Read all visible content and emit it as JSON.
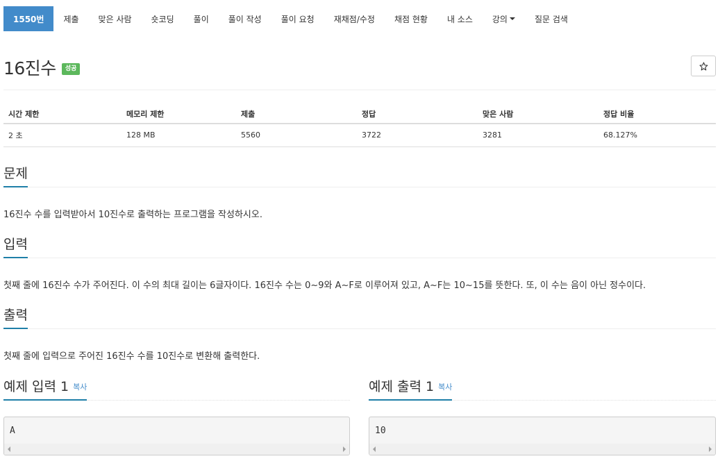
{
  "nav": {
    "items": [
      {
        "label": "1550번",
        "active": true,
        "name": "nav-problem-number"
      },
      {
        "label": "제출",
        "active": false,
        "name": "nav-submit"
      },
      {
        "label": "맞은 사람",
        "active": false,
        "name": "nav-solved-users"
      },
      {
        "label": "숏코딩",
        "active": false,
        "name": "nav-short-coding"
      },
      {
        "label": "풀이",
        "active": false,
        "name": "nav-solution"
      },
      {
        "label": "풀이 작성",
        "active": false,
        "name": "nav-write-solution"
      },
      {
        "label": "풀이 요청",
        "active": false,
        "name": "nav-request-solution"
      },
      {
        "label": "재채점/수정",
        "active": false,
        "name": "nav-rejudge"
      },
      {
        "label": "채점 현황",
        "active": false,
        "name": "nav-status"
      },
      {
        "label": "내 소스",
        "active": false,
        "name": "nav-my-source"
      },
      {
        "label": "강의",
        "active": false,
        "name": "nav-lecture",
        "dropdown": true
      },
      {
        "label": "질문 검색",
        "active": false,
        "name": "nav-question-search"
      }
    ]
  },
  "problem": {
    "title": "16진수",
    "badge": "성공",
    "badge_color": "#5cb85c",
    "star_icon": "star-icon"
  },
  "stats": {
    "headers": [
      "시간 제한",
      "메모리 제한",
      "제출",
      "정답",
      "맞은 사람",
      "정답 비율"
    ],
    "values": [
      "2 초",
      "128 MB",
      "5560",
      "3722",
      "3281",
      "68.127%"
    ]
  },
  "sections": {
    "problem_heading": "문제",
    "problem_text": "16진수 수를 입력받아서 10진수로 출력하는 프로그램을 작성하시오.",
    "input_heading": "입력",
    "input_text": "첫째 줄에 16진수 수가 주어진다. 이 수의 최대 길이는 6글자이다. 16진수 수는 0~9와 A~F로 이루어져 있고, A~F는 10~15를 뜻한다. 또, 이 수는 음이 아닌 정수이다.",
    "output_heading": "출력",
    "output_text": "첫째 줄에 입력으로 주어진 16진수 수를 10진수로 변환해 출력한다."
  },
  "examples": {
    "input_heading": "예제 입력 1",
    "output_heading": "예제 출력 1",
    "copy_label": "복사",
    "input_value": "A",
    "output_value": "10"
  },
  "colors": {
    "accent": "#428bca",
    "heading_underline": "#1e7fa8"
  }
}
